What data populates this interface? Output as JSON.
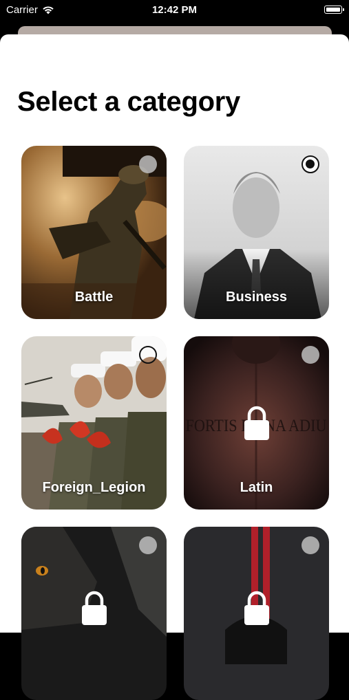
{
  "status_bar": {
    "carrier": "Carrier",
    "time": "12:42 PM"
  },
  "title": "Select a category",
  "categories": [
    {
      "label": "Battle",
      "locked": false,
      "selection": "empty"
    },
    {
      "label": "Business",
      "locked": false,
      "selection": "selected"
    },
    {
      "label": "Foreign_Legion",
      "locked": false,
      "selection": "outline"
    },
    {
      "label": "Latin",
      "locked": true,
      "selection": "empty",
      "tattoo_text": "FORTIS F  UNA ADIU"
    },
    {
      "label": "",
      "locked": true,
      "selection": "empty"
    },
    {
      "label": "",
      "locked": true,
      "selection": "empty"
    }
  ]
}
